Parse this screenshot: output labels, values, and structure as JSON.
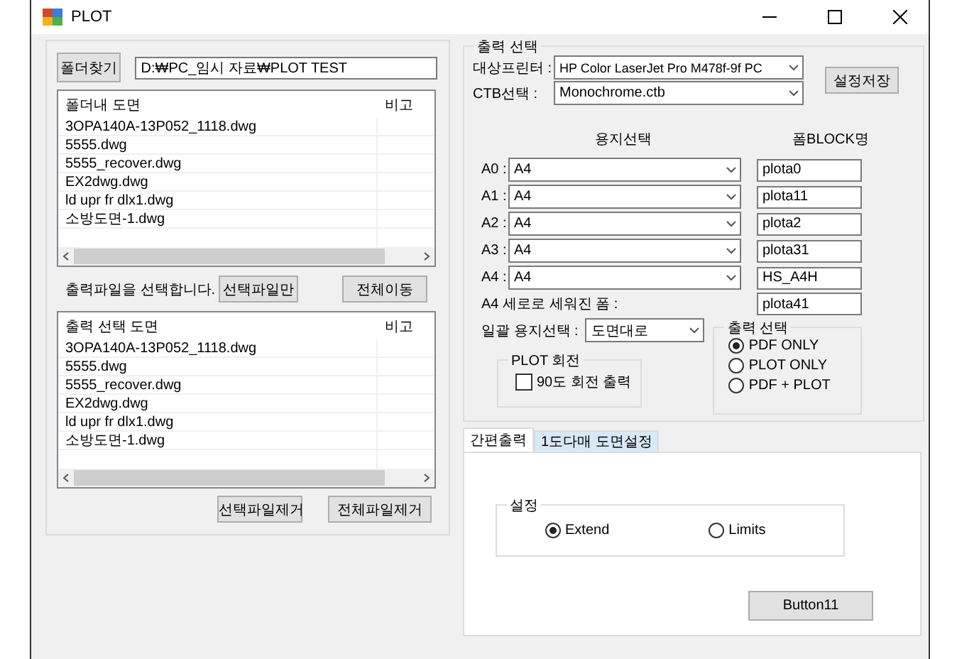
{
  "window": {
    "title": "PLOT"
  },
  "folder": {
    "button": "폴더찾기",
    "path": "D:₩PC_임시 자료₩PLOT TEST"
  },
  "folder_list": {
    "columns": [
      "폴더내 도면",
      "비고"
    ],
    "rows": [
      "3OPA140A-13P052_1118.dwg",
      "5555.dwg",
      "5555_recover.dwg",
      "EX2dwg.dwg",
      "ld upr fr dlx1.dwg",
      "소방도면-1.dwg"
    ]
  },
  "select_hint": "출력파일을 선택합니다.",
  "move_buttons": [
    "선택파일만",
    "전체이동"
  ],
  "output_list": {
    "columns": [
      "출력 선택 도면",
      "비고"
    ],
    "rows": [
      "3OPA140A-13P052_1118.dwg",
      "5555.dwg",
      "5555_recover.dwg",
      "EX2dwg.dwg",
      "ld upr fr dlx1.dwg",
      "소방도면-1.dwg"
    ]
  },
  "remove_buttons": [
    "선택파일제거",
    "전체파일제거"
  ],
  "output_group": {
    "title": "출력 선택",
    "printer_label": "대상프린터 :",
    "printer": "HP Color LaserJet Pro M478f-9f PC",
    "ctb_label": "CTB선택 :",
    "ctb": "Monochrome.ctb",
    "save_button": "설정저장",
    "paper_heading": "용지선택",
    "block_heading": "폼BLOCK명",
    "papers": [
      {
        "label": "A0 :",
        "paper": "A4",
        "block": "plota0"
      },
      {
        "label": "A1 :",
        "paper": "A4",
        "block": "plota11"
      },
      {
        "label": "A2 :",
        "paper": "A4",
        "block": "plota2"
      },
      {
        "label": "A3 :",
        "paper": "A4",
        "block": "plota31"
      },
      {
        "label": "A4 :",
        "paper": "A4",
        "block": "HS_A4H"
      }
    ],
    "a4_portrait_label": "A4 세로로 세워진 폼 :",
    "a4_portrait_block": "plota41",
    "bulk_label": "일괄 용지선택 :",
    "bulk_paper": "도면대로",
    "rotate_group": {
      "title": "PLOT 회전",
      "checkbox": {
        "label": "90도 회전 출력",
        "checked": false
      }
    },
    "mode_group": {
      "title": "출력 선택",
      "options": [
        {
          "label": "PDF ONLY",
          "selected": true
        },
        {
          "label": "PLOT ONLY",
          "selected": false
        },
        {
          "label": "PDF + PLOT",
          "selected": false
        }
      ]
    }
  },
  "tabs": [
    {
      "label": "간편출력",
      "selected": true
    },
    {
      "label": "1도다매 도면설정",
      "selected": false
    }
  ],
  "settings_group": {
    "title": "설정",
    "options": [
      {
        "label": "Extend",
        "selected": true
      },
      {
        "label": "Limits",
        "selected": false
      }
    ]
  },
  "action_button": "Button11"
}
